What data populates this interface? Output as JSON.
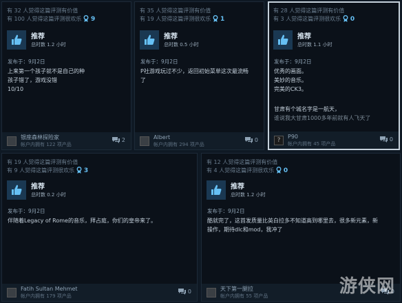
{
  "reviews": [
    {
      "helpful": "有 32 人觉得这篇评测有价值",
      "funny": "有 100 人觉得这篇评测很欢乐",
      "awards": "9",
      "recommendation": "推荐",
      "hours": "总时数 1.2 小时",
      "posted": "发布于：9月2日",
      "text": "上来第一个孩子就不是自己的种\n孩子错了，游戏没错\n10/10",
      "author": "银座森林探险家",
      "author_games": "帐户内拥有 122 项产品",
      "comments": "2"
    },
    {
      "helpful": "有 35 人觉得这篇评测有价值",
      "funny": "有 19 人觉得这篇评测很欢乐",
      "awards": "1",
      "recommendation": "推荐",
      "hours": "总时数 0.5 小时",
      "posted": "发布于：9月2日",
      "text": "P社游戏玩过不少，返回初始菜单这次最流畅\n了",
      "author": "Albert",
      "author_games": "帐户内拥有 294 项产品",
      "comments": "0"
    },
    {
      "helpful": "有 28 人觉得这篇评测有价值",
      "funny": "有 3 人觉得这篇评测很欢乐",
      "awards": "0",
      "recommendation": "推荐",
      "hours": "总时数 1.1 小时",
      "posted": "发布于：9月2日",
      "text": "优秀的画面。\n美妙的音乐。\n完美的CK3。",
      "text_extra": "甘肃有个城名字是一航天，",
      "text_faded": "谁说我大甘肃1000多年前就有人飞天了",
      "author": "P90",
      "author_games": "帐户内拥有 45 项产品",
      "comments": "0"
    },
    {
      "helpful": "有 19 人觉得这篇评测有价值",
      "funny": "有 9 人觉得这篇评测很欢乐",
      "awards": "3",
      "recommendation": "推荐",
      "hours": "总时数 0.2 小时",
      "posted": "发布于：9月2日",
      "text": "伴随着Legacy of Rome的音乐，拜占庭，你们的皇帝来了。",
      "author": "Fatih Sultan Mehmet",
      "author_games": "帐户内拥有 179 项产品",
      "comments": "0"
    },
    {
      "helpful": "有 12 人觉得这篇评测有价值",
      "funny": "有 4 人觉得这篇评测很欢乐",
      "awards": "0",
      "recommendation": "推荐",
      "hours": "总时数 1.2 小时",
      "posted": "发布于：9月2日",
      "text": "酷就完了，这首发质量比英白拉多不知道高到哪里去，很多新元素，新\n操作，期待dlc和mod，我冲了",
      "author": "天下第一腿拉",
      "author_games": "帐户内拥有 55 项产品",
      "comments": "0"
    }
  ],
  "watermark": "游侠网",
  "colors": {
    "accent": "#66c0f4",
    "thumb_bg": "#1a3852",
    "card_bg": "#0b1119"
  },
  "icons": {
    "award": "award-ribbon-icon",
    "thumb": "thumbs-up-icon",
    "comment": "comment-bubble-icon"
  }
}
